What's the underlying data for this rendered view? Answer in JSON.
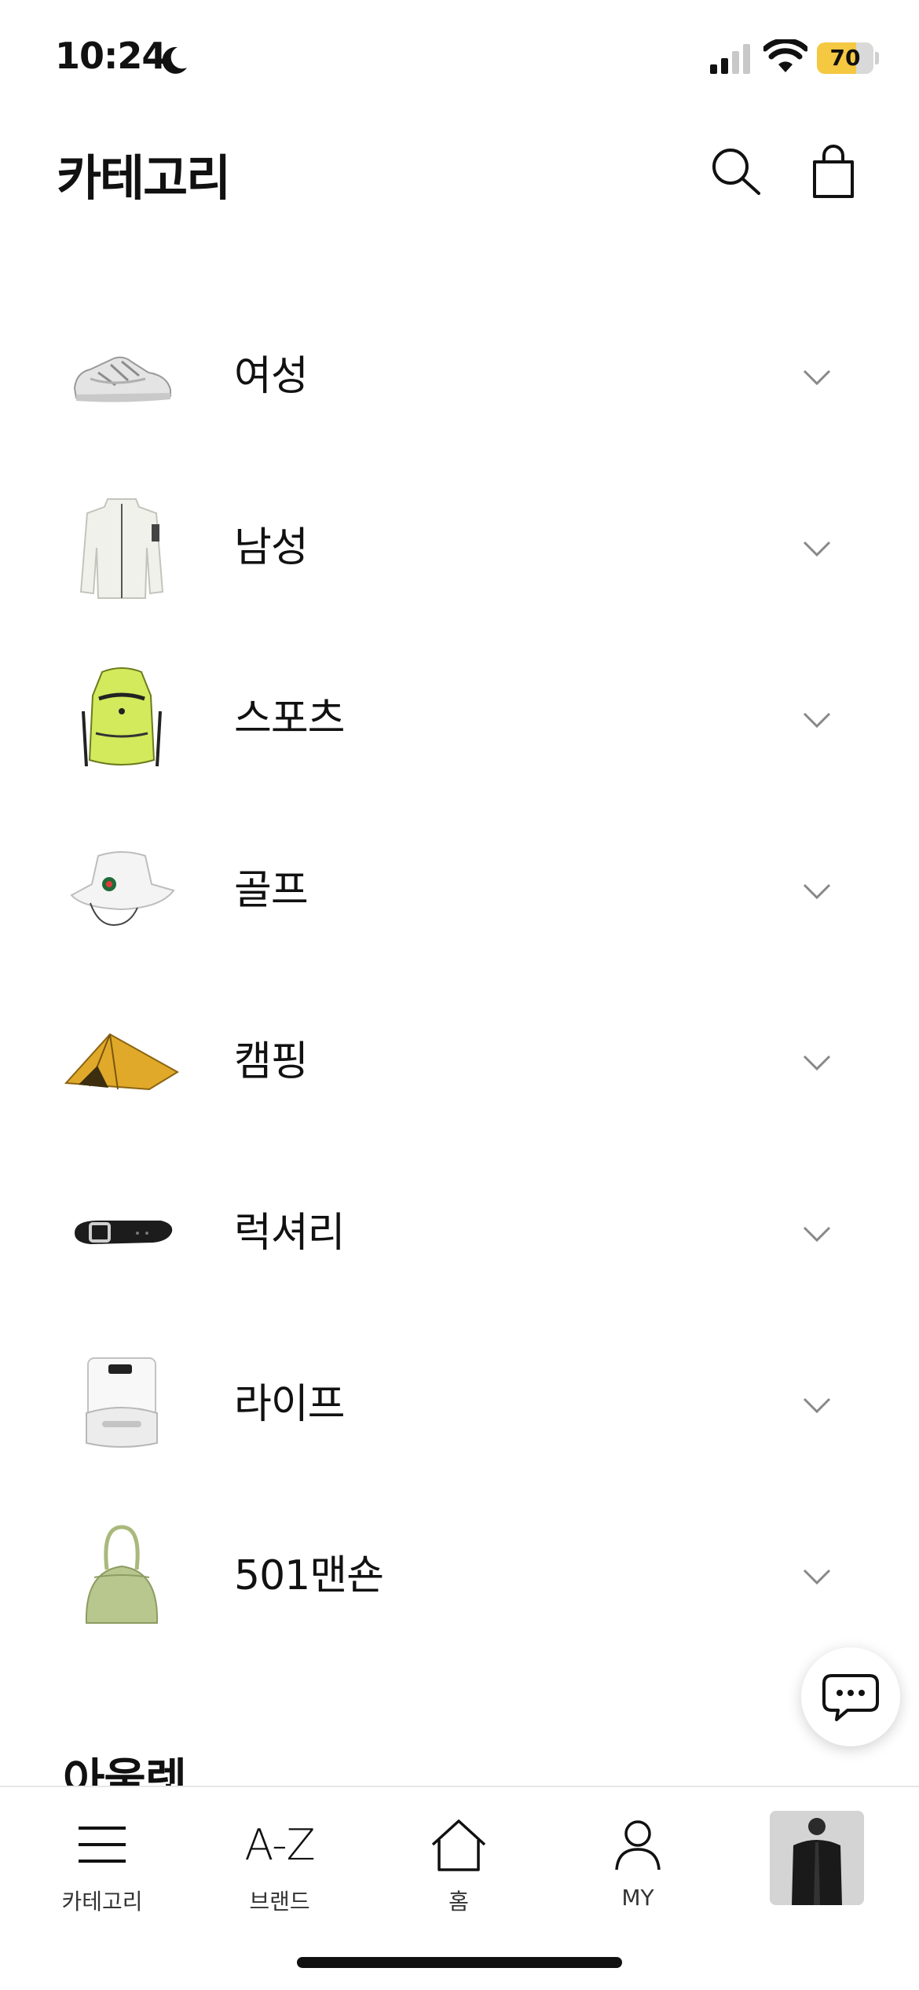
{
  "status_bar": {
    "time": "10:24",
    "battery": "70",
    "battery_level": 0.7
  },
  "header": {
    "title": "카테고리"
  },
  "categories": [
    {
      "label": "여성",
      "thumb": "sneaker"
    },
    {
      "label": "남성",
      "thumb": "jacket"
    },
    {
      "label": "스포츠",
      "thumb": "backpack"
    },
    {
      "label": "골프",
      "thumb": "bucket-hat"
    },
    {
      "label": "캠핑",
      "thumb": "tent"
    },
    {
      "label": "럭셔리",
      "thumb": "belt"
    },
    {
      "label": "라이프",
      "thumb": "robot-vacuum"
    },
    {
      "label": "501맨숀",
      "thumb": "handbag"
    }
  ],
  "section": {
    "next_heading": "아울렛"
  },
  "tab_bar": {
    "category": "카테고리",
    "brand_icon": "A-Z",
    "brand": "브랜드",
    "home": "홈",
    "my": "MY"
  },
  "colors": {
    "accent_battery": "#f5c842",
    "text": "#111111",
    "chevron": "#888888"
  }
}
